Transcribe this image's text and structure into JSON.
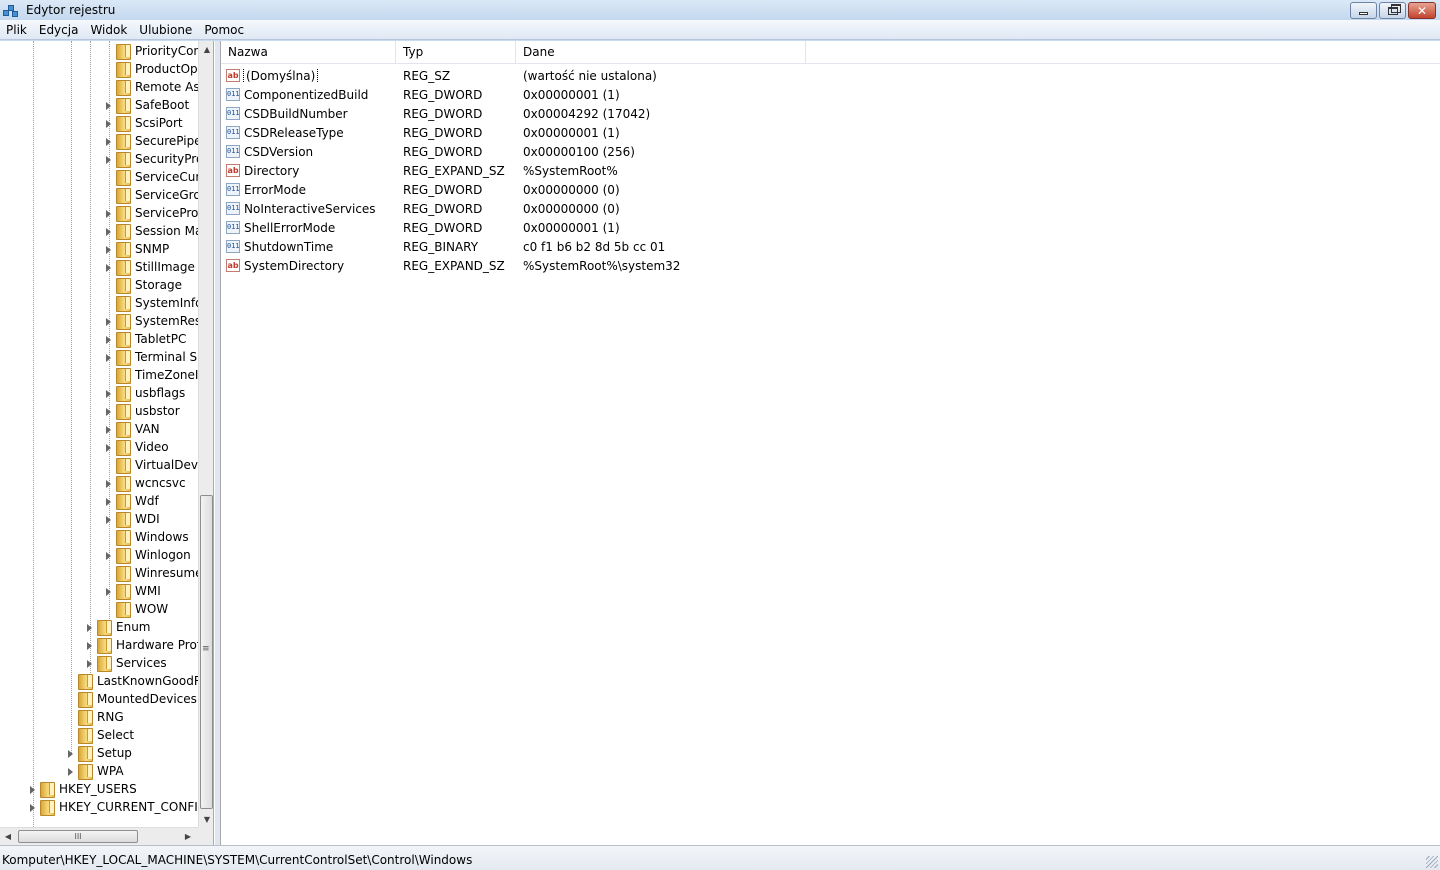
{
  "window": {
    "title": "Edytor rejestru",
    "controls": [
      "minimize-icon",
      "restore-icon",
      "close-icon"
    ]
  },
  "menu": [
    "Plik",
    "Edycja",
    "Widok",
    "Ulubione",
    "Pomoc"
  ],
  "tree": [
    {
      "label": "PriorityCon",
      "level": 4,
      "expandable": false
    },
    {
      "label": "ProductOp",
      "level": 4,
      "expandable": false
    },
    {
      "label": "Remote As",
      "level": 4,
      "expandable": false
    },
    {
      "label": "SafeBoot",
      "level": 4,
      "expandable": true
    },
    {
      "label": "ScsiPort",
      "level": 4,
      "expandable": true
    },
    {
      "label": "SecurePipe",
      "level": 4,
      "expandable": true
    },
    {
      "label": "SecurityPro",
      "level": 4,
      "expandable": true
    },
    {
      "label": "ServiceCur",
      "level": 4,
      "expandable": false
    },
    {
      "label": "ServiceGro",
      "level": 4,
      "expandable": false
    },
    {
      "label": "ServiceProv",
      "level": 4,
      "expandable": true
    },
    {
      "label": "Session Ma",
      "level": 4,
      "expandable": true
    },
    {
      "label": "SNMP",
      "level": 4,
      "expandable": true
    },
    {
      "label": "StillImage",
      "level": 4,
      "expandable": true
    },
    {
      "label": "Storage",
      "level": 4,
      "expandable": false
    },
    {
      "label": "SystemInfo",
      "level": 4,
      "expandable": false
    },
    {
      "label": "SystemRes",
      "level": 4,
      "expandable": true
    },
    {
      "label": "TabletPC",
      "level": 4,
      "expandable": true
    },
    {
      "label": "Terminal S",
      "level": 4,
      "expandable": true
    },
    {
      "label": "TimeZoneI",
      "level": 4,
      "expandable": false
    },
    {
      "label": "usbflags",
      "level": 4,
      "expandable": true
    },
    {
      "label": "usbstor",
      "level": 4,
      "expandable": true
    },
    {
      "label": "VAN",
      "level": 4,
      "expandable": true
    },
    {
      "label": "Video",
      "level": 4,
      "expandable": true
    },
    {
      "label": "VirtualDevi",
      "level": 4,
      "expandable": false
    },
    {
      "label": "wcncsvc",
      "level": 4,
      "expandable": true
    },
    {
      "label": "Wdf",
      "level": 4,
      "expandable": true
    },
    {
      "label": "WDI",
      "level": 4,
      "expandable": true
    },
    {
      "label": "Windows",
      "level": 4,
      "expandable": false
    },
    {
      "label": "Winlogon",
      "level": 4,
      "expandable": true
    },
    {
      "label": "Winresume",
      "level": 4,
      "expandable": false
    },
    {
      "label": "WMI",
      "level": 4,
      "expandable": true
    },
    {
      "label": "WOW",
      "level": 4,
      "expandable": false
    },
    {
      "label": "Enum",
      "level": 3,
      "expandable": true
    },
    {
      "label": "Hardware Prof",
      "level": 3,
      "expandable": true
    },
    {
      "label": "Services",
      "level": 3,
      "expandable": true
    },
    {
      "label": "LastKnownGoodR",
      "level": 2,
      "expandable": false
    },
    {
      "label": "MountedDevices",
      "level": 2,
      "expandable": false
    },
    {
      "label": "RNG",
      "level": 2,
      "expandable": false
    },
    {
      "label": "Select",
      "level": 2,
      "expandable": false
    },
    {
      "label": "Setup",
      "level": 2,
      "expandable": true
    },
    {
      "label": "WPA",
      "level": 2,
      "expandable": true
    },
    {
      "label": "HKEY_USERS",
      "level": 0,
      "expandable": true
    },
    {
      "label": "HKEY_CURRENT_CONFIG",
      "level": 0,
      "expandable": true
    }
  ],
  "scroll_glyphs": {
    "up": "▲",
    "down": "▼",
    "left": "◀",
    "right": "▶",
    "grip": "III",
    "vgrip": "≡"
  },
  "list": {
    "columns": [
      "Nazwa",
      "Typ",
      "Dane"
    ],
    "rows": [
      {
        "icon": "ab",
        "name": "(Domyślna)",
        "type": "REG_SZ",
        "data": "(wartość nie ustalona)",
        "focused": true
      },
      {
        "icon": "bin",
        "name": "ComponentizedBuild",
        "type": "REG_DWORD",
        "data": "0x00000001 (1)"
      },
      {
        "icon": "bin",
        "name": "CSDBuildNumber",
        "type": "REG_DWORD",
        "data": "0x00004292 (17042)"
      },
      {
        "icon": "bin",
        "name": "CSDReleaseType",
        "type": "REG_DWORD",
        "data": "0x00000001 (1)"
      },
      {
        "icon": "bin",
        "name": "CSDVersion",
        "type": "REG_DWORD",
        "data": "0x00000100 (256)"
      },
      {
        "icon": "ab",
        "name": "Directory",
        "type": "REG_EXPAND_SZ",
        "data": "%SystemRoot%"
      },
      {
        "icon": "bin",
        "name": "ErrorMode",
        "type": "REG_DWORD",
        "data": "0x00000000 (0)"
      },
      {
        "icon": "bin",
        "name": "NoInteractiveServices",
        "type": "REG_DWORD",
        "data": "0x00000000 (0)"
      },
      {
        "icon": "bin",
        "name": "ShellErrorMode",
        "type": "REG_DWORD",
        "data": "0x00000001 (1)"
      },
      {
        "icon": "bin",
        "name": "ShutdownTime",
        "type": "REG_BINARY",
        "data": "c0 f1 b6 b2 8d 5b cc 01"
      },
      {
        "icon": "ab",
        "name": "SystemDirectory",
        "type": "REG_EXPAND_SZ",
        "data": "%SystemRoot%\\system32"
      }
    ]
  },
  "status": "Komputer\\HKEY_LOCAL_MACHINE\\SYSTEM\\CurrentControlSet\\Control\\Windows",
  "icon_glyphs": {
    "ab": "ab",
    "bin": "011"
  }
}
